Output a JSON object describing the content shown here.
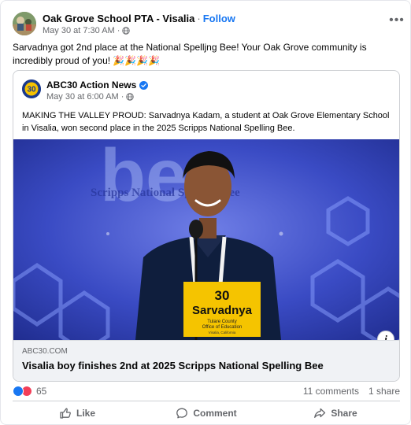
{
  "post": {
    "page_name": "Oak Grove School PTA - Visalia",
    "separator": "·",
    "follow_label": "Follow",
    "timestamp": "May 30 at 7:30 AM",
    "meta_separator": "·",
    "audience_icon": "globe-icon",
    "more_icon": "more-options-icon",
    "more_label": "•••",
    "text": "Sarvadnya got 2nd place at the National Spelljng Bee! Your Oak Grove community is incredibly proud of you! 🎉🎉🎉🎉"
  },
  "shared_post": {
    "page_name": "ABC30 Action News",
    "verified_icon": "verified-badge-icon",
    "timestamp": "May 30 at 6:00 AM",
    "meta_separator": "·",
    "text": "MAKING THE VALLEY PROUD: Sarvadnya Kadam, a student at Oak Grove Elementary School in Visalia, won second place in the 2025 Scripps National Spelling Bee.",
    "photo": {
      "placard_number": "30",
      "placard_name": "Sarvadnya",
      "placard_line1": "Tulare County",
      "placard_line2": "Office of Education",
      "placard_line3": "Visalia, California",
      "backdrop_text": "Scripps National Spelling Bee",
      "backdrop_logo": "bee",
      "info_label": "i"
    },
    "link": {
      "domain": "ABC30.COM",
      "title": "Visalia boy finishes 2nd at 2025 Scripps National Spelling Bee"
    }
  },
  "engagement": {
    "reactions_count": "65",
    "comments": "11 comments",
    "shares": "1 share"
  },
  "actions": {
    "like_label": "Like",
    "comment_label": "Comment",
    "share_label": "Share"
  },
  "colors": {
    "accent": "#1877f2",
    "like": "#1877f2",
    "love": "#f33e58",
    "placard": "#f5c400"
  }
}
